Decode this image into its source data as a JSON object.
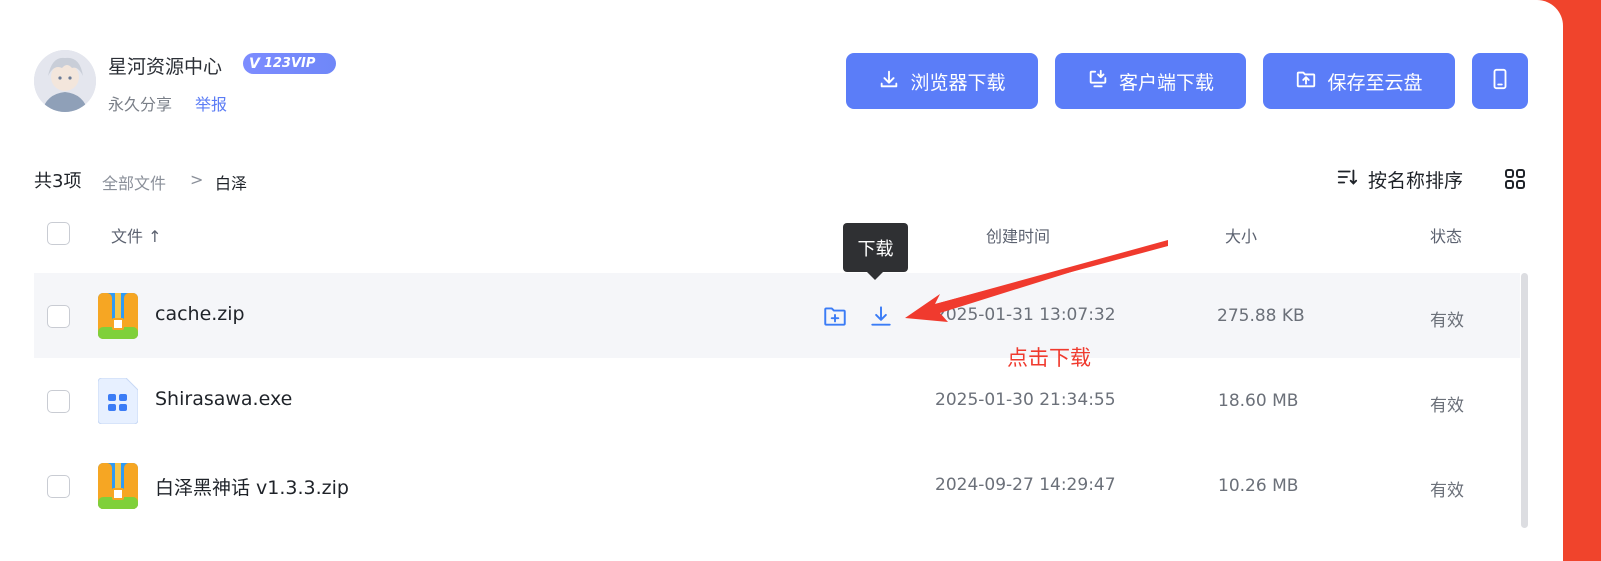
{
  "colors": {
    "accent": "#5b7df8",
    "page_border": "#f0442c",
    "annotation": "#f03a2e",
    "tooltip_bg": "#2f3033"
  },
  "header": {
    "owner_name": "星河资源中心",
    "vip_badge": "123VIP",
    "share_type": "永久分享",
    "report_label": "举报"
  },
  "actions": {
    "browser_download": "浏览器下载",
    "client_download": "客户端下载",
    "save_to_cloud": "保存至云盘",
    "mobile_icon": "mobile-phone-icon"
  },
  "toolbar": {
    "count": "共3项",
    "breadcrumb_root": "全部文件",
    "breadcrumb_sep": ">",
    "breadcrumb_current": "白泽",
    "sort_label": "按名称排序"
  },
  "table": {
    "columns": {
      "file": "文件 ↑",
      "created": "创建时间",
      "size": "大小",
      "status": "状态"
    },
    "rows": [
      {
        "name": "cache.zip",
        "created": "2025-01-31 13:07:32",
        "size": "275.88 KB",
        "status": "有效",
        "icon": "zip-icon"
      },
      {
        "name": "Shirasawa.exe",
        "created": "2025-01-30 21:34:55",
        "size": "18.60 MB",
        "status": "有效",
        "icon": "exe-icon"
      },
      {
        "name": "白泽黑神话 v1.3.3.zip",
        "created": "2024-09-27 14:29:47",
        "size": "10.26 MB",
        "status": "有效",
        "icon": "zip-icon"
      }
    ]
  },
  "tooltip": {
    "text": "下载"
  },
  "annotation": {
    "text": "点击下载"
  }
}
